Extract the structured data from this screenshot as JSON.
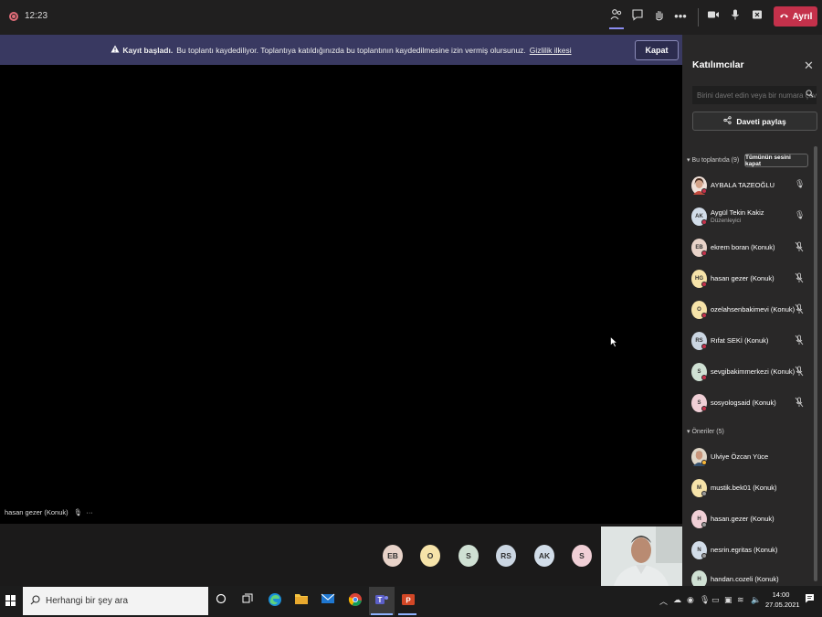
{
  "topbar": {
    "timer": "12:23",
    "leave_label": "Ayrıl"
  },
  "banner": {
    "bold": "Kayıt başladı.",
    "message": "Bu toplantı kaydediliyor. Toplantıya katıldığınızda bu toplantının kaydedilmesine izin vermiş olursunuz.",
    "link": "Gizlilik ilkesi",
    "close_label": "Kapat"
  },
  "stage": {
    "speaker_label": "hasan gezer (Konuk)"
  },
  "bottom_avatars": [
    {
      "initials": "EB",
      "color": "#e8d3c9"
    },
    {
      "initials": "O",
      "color": "#f6e3a9"
    },
    {
      "initials": "S",
      "color": "#cfe0d3"
    },
    {
      "initials": "RS",
      "color": "#cbd6e2"
    },
    {
      "initials": "AK",
      "color": "#d2dde9"
    },
    {
      "initials": "S",
      "color": "#f0cfd6"
    }
  ],
  "panel": {
    "title": "Katılımcılar",
    "invite_placeholder": "Birini davet edin veya bir numara çevirin",
    "share_label": "Daveti paylaş",
    "in_meeting_header": "Bu toplantıda (9)",
    "mute_all_label": "Tümünün sesini kapat",
    "suggestions_header": "Öneriler (5)",
    "participants": [
      {
        "initials": "",
        "name": "AYBALA TAZEOĞLU",
        "role": "",
        "color": "#f0e1d9",
        "photo": true
      },
      {
        "initials": "AK",
        "name": "Aygül Tekin Kakiz",
        "role": "Düzenleyici",
        "color": "#d2dde9"
      },
      {
        "initials": "EB",
        "name": "ekrem boran (Konuk)",
        "role": "",
        "color": "#e8d3c9"
      },
      {
        "initials": "HG",
        "name": "hasan gezer (Konuk)",
        "role": "",
        "color": "#f6e3a9"
      },
      {
        "initials": "O",
        "name": "ozelahsenbakimevi (Konuk)",
        "role": "",
        "color": "#f6e3a9"
      },
      {
        "initials": "RS",
        "name": "Rıfat SEKİ (Konuk)",
        "role": "",
        "color": "#cbd6e2"
      },
      {
        "initials": "S",
        "name": "sevgibakimmerkezi (Konuk)",
        "role": "",
        "color": "#cfe0d3"
      },
      {
        "initials": "S",
        "name": "sosyologsaid (Konuk)",
        "role": "",
        "color": "#f0cfd6"
      }
    ],
    "suggestions": [
      {
        "initials": "",
        "name": "Ulviye Özcan Yüce",
        "color": "#e0d7c8",
        "photo": true
      },
      {
        "initials": "M",
        "name": "mustik.bek01 (Konuk)",
        "color": "#f6e3a9"
      },
      {
        "initials": "H",
        "name": "hasan.gezer (Konuk)",
        "color": "#f0cfd6"
      },
      {
        "initials": "N",
        "name": "nesrin.egritas (Konuk)",
        "color": "#d2dde9"
      },
      {
        "initials": "H",
        "name": "handan.cozeli (Konuk)",
        "color": "#cfe0d3"
      }
    ]
  },
  "taskbar": {
    "search_placeholder": "Herhangi bir şey ara",
    "time": "14:00",
    "date": "27.05.2021"
  }
}
